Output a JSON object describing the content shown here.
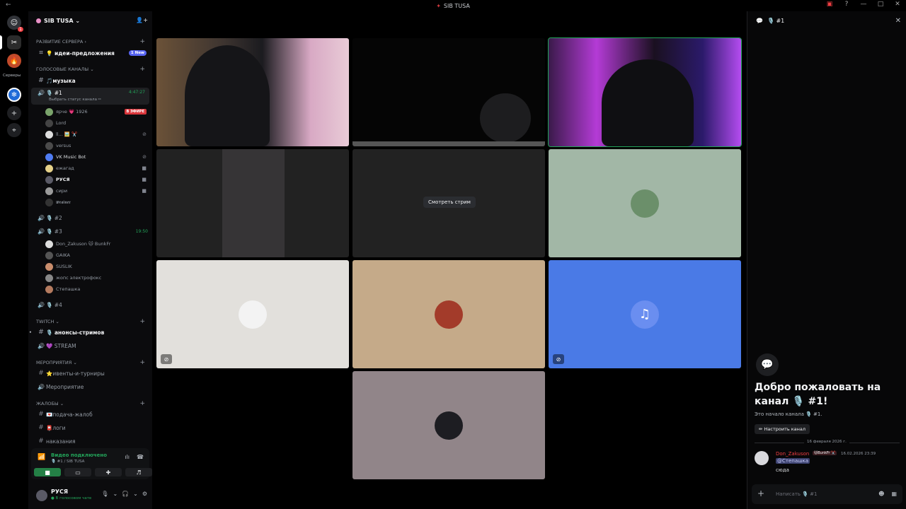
{
  "window": {
    "title": "SIB TUSA",
    "back": "←",
    "controls": [
      "▣",
      "?",
      "—",
      "□",
      "✕"
    ]
  },
  "guilds": {
    "badge": "1",
    "servers_label": "Серверы"
  },
  "server": {
    "name": "SIB TUSA ⌄"
  },
  "sidebar": {
    "cat_dev": "РАЗВИТИЕ СЕРВЕРА ›",
    "ch_ideas": "💡 идеи-предложения",
    "ch_ideas_badge": "1 New",
    "cat_voice": "ГОЛОСОВЫЕ КАНАЛЫ ⌄",
    "ch_music": "🎵музыка",
    "ch_1": "🎙️ #1",
    "ch_1_time": "4:47:27",
    "ch_1_status": "Выбрать статус канала ✏",
    "users_1": [
      {
        "name": "ярче 💗 1926",
        "color": "#7aa36b",
        "live": "В ЭФИРЕ"
      },
      {
        "name": "Lord",
        "color": "#444"
      },
      {
        "name": "ll... 🖼️ ✂️",
        "color": "#ddd"
      },
      {
        "name": "versus",
        "color": "#4b4b4b"
      },
      {
        "name": "VK Music Bot",
        "color": "#4f7cf3"
      },
      {
        "name": "ежагад",
        "color": "#e6d28a"
      },
      {
        "name": "РУСЯ",
        "color": "#5a5a66"
      },
      {
        "name": "сири",
        "color": "#9b9b9b"
      },
      {
        "name": "𝖜𝖗𝖆𝖎𝖓𝖊𝖗",
        "color": "#333"
      }
    ],
    "ch_2": "🎙️ #2",
    "ch_3": "🎙️ #3",
    "ch_3_time": "19:50",
    "users_3": [
      {
        "name": "Don_Zakuson 🐱 BunkFr",
        "color": "#ddd"
      },
      {
        "name": "GAIKA",
        "color": "#555"
      },
      {
        "name": "SUSLIK",
        "color": "#c98d6c"
      },
      {
        "name": "жопс электрофокс",
        "color": "#888"
      },
      {
        "name": "Степашка",
        "color": "#b57b5f"
      }
    ],
    "ch_4": "🎙️ #4",
    "cat_twitch": "TWITCH ⌄",
    "ch_announce": "🎙️ анонсы-стримов",
    "ch_stream": "💜 STREAM",
    "cat_events": "МЕРОПРИЯТИЯ ⌄",
    "ch_events": "⭐ивенты-и-турниры",
    "ch_event_voice": "Мероприятие",
    "cat_complaints": "ЖАЛОБЫ ⌄",
    "ch_complaint": "💌подача-жалоб",
    "ch_logs": "📮логи",
    "ch_punish": "наказания"
  },
  "voice": {
    "status": "Видео подключено",
    "channel": "🎙️ #1 / SIB TUSA"
  },
  "userpanel": {
    "name": "РУСЯ",
    "status": "● В голосовом чате"
  },
  "stage": {
    "watch_label": "Смотреть стрим"
  },
  "chat": {
    "title": "🎙️ #1",
    "welcome_title": "Добро пожаловать на канал 🎙️ #1!",
    "welcome_sub": "Это начало канала 🎙️ #1.",
    "setup_button": "✏ Настроить канал",
    "date_divider": "16 февраля 2026 г.",
    "msg_author": "Don_Zakuson",
    "msg_tag": "🐱BunkFr ✂️",
    "msg_time": "16.02.2026 23:39",
    "msg_mention": "@Степашка",
    "msg_text": "сюда",
    "input_placeholder": "Написать 🎙️ #1"
  }
}
